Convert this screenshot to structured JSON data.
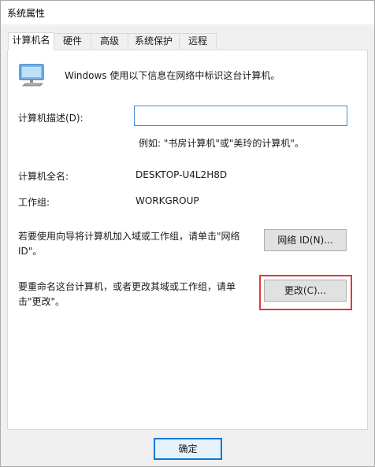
{
  "window": {
    "title": "系统属性"
  },
  "tabs": [
    {
      "label": "计算机名",
      "active": true
    },
    {
      "label": "硬件",
      "active": false
    },
    {
      "label": "高级",
      "active": false
    },
    {
      "label": "系统保护",
      "active": false
    },
    {
      "label": "远程",
      "active": false
    }
  ],
  "info": {
    "text": "Windows 使用以下信息在网络中标识这台计算机。",
    "icon": "computer-icon"
  },
  "description": {
    "label": "计算机描述(D):",
    "value": "",
    "example": "例如: \"书房计算机\"或\"美玲的计算机\"。"
  },
  "full_name": {
    "label": "计算机全名:",
    "value": "DESKTOP-U4L2H8D"
  },
  "workgroup": {
    "label": "工作组:",
    "value": "WORKGROUP"
  },
  "network_id": {
    "text": "若要使用向导将计算机加入域或工作组，请单击\"网络 ID\"。",
    "button_label": "网络 ID(N)..."
  },
  "rename": {
    "text": "要重命名这台计算机，或者更改其域或工作组，请单击\"更改\"。",
    "button_label": "更改(C)..."
  },
  "footer": {
    "ok_label": "确定"
  },
  "colors": {
    "accent": "#0078d7",
    "highlight_box": "#e0393e"
  }
}
